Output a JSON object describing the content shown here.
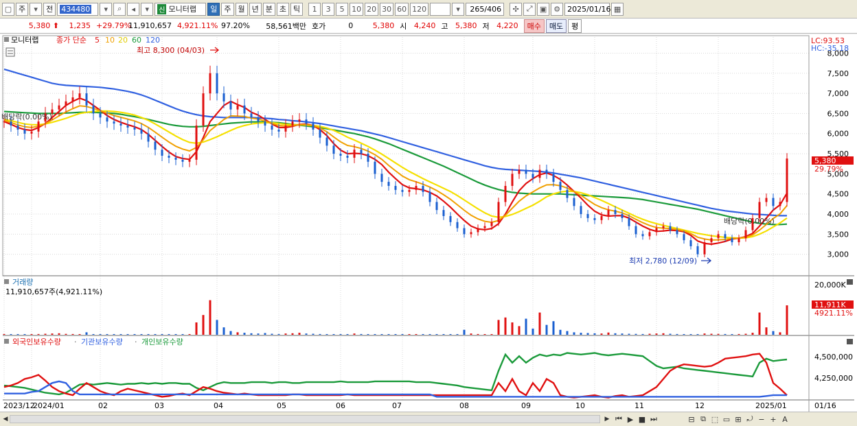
{
  "toolbar": {
    "type_label": "주",
    "all_label": "전",
    "code": "434480",
    "new_badge": "신",
    "stock_name": "모니터랩",
    "period_buttons": [
      "일",
      "주",
      "월",
      "년",
      "분",
      "초",
      "틱"
    ],
    "interval_buttons": [
      "1",
      "3",
      "5",
      "10",
      "20",
      "30",
      "60",
      "120"
    ],
    "count": "265",
    "total": "/406",
    "date": "2025/01/16"
  },
  "quote": {
    "price": "5,380",
    "change": "1,235",
    "change_pct": "+29.79%",
    "volume": "11,910,657",
    "volume_pct": "4,921.11%",
    "ratio": "97.20%",
    "amount": "58,561백만",
    "bid_label": "호가",
    "bid_value": "0",
    "last": "5,380",
    "open_label": "시",
    "open": "4,240",
    "high_label": "고",
    "high": "5,380",
    "low_label": "저",
    "low": "4,220",
    "buy_label": "매수",
    "sell_label": "매도",
    "avg_label": "평"
  },
  "price_panel": {
    "name": "모니터랩",
    "ma_prefix": "종가 단순",
    "ma_periods": [
      "5",
      "10",
      "20",
      "60",
      "120"
    ],
    "ma_colors": [
      "#e01010",
      "#f0a000",
      "#f5e000",
      "#1a9a3a",
      "#3060e0"
    ],
    "max_label": "최고 8,300 (04/03)",
    "min_label": "최저 2,780 (12/09)",
    "dividend_left": "배당락(0.00%)",
    "dividend_right": "배당락(0.00%)",
    "lc": "LC:93.53",
    "hc": "HC:-35.18",
    "last_price_tag": "5,380",
    "last_pct_tag": "29.79%"
  },
  "volume_panel": {
    "name": "거래량",
    "value_label": "11,910,657주(4,921.11%)",
    "axis_top": "20,000K",
    "tag_value": "11,911K",
    "tag_pct": "4921.11%"
  },
  "holding_panel": {
    "series": [
      "외국인보유수량",
      "기관보유수량",
      "개인보유수량"
    ],
    "series_colors": [
      "#e01010",
      "#3060e0",
      "#1a9a3a"
    ],
    "ticks": [
      "4,500,000",
      "4,250,000"
    ]
  },
  "x_axis": {
    "labels": [
      "2023/12",
      "2024/01",
      "02",
      "03",
      "04",
      "05",
      "06",
      "07",
      "08",
      "09",
      "10",
      "11",
      "12",
      "2025/01",
      "01/16"
    ]
  },
  "chart_data": {
    "type": "line",
    "price_axis": {
      "ticks": [
        8000,
        7500,
        7000,
        6500,
        6000,
        5500,
        5000,
        4500,
        4000,
        3500,
        3000
      ],
      "tick_labels": [
        "8,000",
        "7,500",
        "7,000",
        "6,500",
        "6,000",
        "5,500",
        "5,000",
        "4,500",
        "4,000",
        "3,500",
        "3,000"
      ],
      "ylim": [
        2500,
        8400
      ]
    },
    "close": [
      6300,
      6200,
      6100,
      6000,
      6050,
      6300,
      6500,
      6600,
      6700,
      6800,
      6900,
      7000,
      6700,
      6500,
      6400,
      6300,
      6250,
      6200,
      6150,
      6100,
      6000,
      5800,
      5600,
      5450,
      5400,
      5350,
      5300,
      5350,
      6200,
      7000,
      7500,
      7000,
      6800,
      6600,
      6700,
      6500,
      6400,
      6300,
      6200,
      6100,
      6050,
      6200,
      6300,
      6350,
      6250,
      6100,
      5900,
      5700,
      5500,
      5450,
      5400,
      5600,
      5500,
      5300,
      5000,
      4800,
      4700,
      4600,
      4550,
      4600,
      4700,
      4550,
      4300,
      4100,
      3950,
      3800,
      3650,
      3500,
      3550,
      3650,
      3700,
      3800,
      4300,
      4700,
      5000,
      5100,
      5000,
      4900,
      5100,
      5000,
      4800,
      4600,
      4400,
      4200,
      4000,
      3900,
      3850,
      3950,
      4100,
      4000,
      3900,
      3700,
      3500,
      3450,
      3550,
      3650,
      3700,
      3600,
      3500,
      3350,
      3200,
      3000,
      3300,
      3400,
      3500,
      3400,
      3300,
      3400,
      3600,
      3900,
      4300,
      4400,
      4200,
      4300,
      5380
    ],
    "ma5": [
      6300,
      6230,
      6150,
      6100,
      6080,
      6150,
      6250,
      6400,
      6550,
      6700,
      6800,
      6880,
      6820,
      6700,
      6580,
      6450,
      6350,
      6280,
      6220,
      6170,
      6100,
      5980,
      5830,
      5680,
      5540,
      5430,
      5380,
      5360,
      5550,
      5900,
      6300,
      6500,
      6700,
      6800,
      6720,
      6650,
      6530,
      6460,
      6350,
      6240,
      6150,
      6150,
      6180,
      6230,
      6240,
      6200,
      6100,
      5950,
      5750,
      5590,
      5500,
      5510,
      5500,
      5450,
      5360,
      5230,
      5040,
      4880,
      4730,
      4650,
      4630,
      4600,
      4540,
      4450,
      4320,
      4170,
      4000,
      3840,
      3700,
      3630,
      3610,
      3640,
      3760,
      4000,
      4300,
      4580,
      4760,
      4880,
      4980,
      5020,
      4960,
      4860,
      4720,
      4560,
      4400,
      4220,
      4070,
      3980,
      3950,
      3960,
      3960,
      3900,
      3800,
      3700,
      3620,
      3570,
      3580,
      3600,
      3590,
      3560,
      3470,
      3330,
      3270,
      3250,
      3280,
      3320,
      3380,
      3400,
      3440,
      3520,
      3700,
      3900,
      4100,
      4230,
      4520
    ],
    "ma20": [
      6350,
      6320,
      6280,
      6240,
      6220,
      6220,
      6240,
      6280,
      6330,
      6380,
      6440,
      6500,
      6530,
      6550,
      6560,
      6560,
      6550,
      6530,
      6500,
      6460,
      6400,
      6330,
      6240,
      6140,
      6040,
      5940,
      5850,
      5780,
      5760,
      5790,
      5850,
      5920,
      6000,
      6080,
      6150,
      6200,
      6240,
      6260,
      6270,
      6270,
      6250,
      6230,
      6220,
      6220,
      6210,
      6200,
      6180,
      6140,
      6080,
      6000,
      5910,
      5840,
      5760,
      5680,
      5590,
      5490,
      5380,
      5270,
      5160,
      5060,
      4970,
      4880,
      4800,
      4720,
      4640,
      4560,
      4460,
      4350,
      4240,
      4130,
      4030,
      3950,
      3920,
      3940,
      3990,
      4060,
      4140,
      4220,
      4320,
      4430,
      4500,
      4550,
      4570,
      4560,
      4530,
      4480,
      4410,
      4340,
      4260,
      4180,
      4100,
      4020,
      3940,
      3870,
      3810,
      3760,
      3720,
      3680,
      3640,
      3600,
      3560,
      3520,
      3490,
      3460,
      3440,
      3420,
      3410,
      3400,
      3410,
      3440,
      3500,
      3580,
      3680,
      3780,
      3900
    ],
    "ma60": [
      6550,
      6540,
      6530,
      6520,
      6510,
      6500,
      6500,
      6500,
      6500,
      6510,
      6520,
      6530,
      6530,
      6530,
      6520,
      6510,
      6500,
      6480,
      6450,
      6420,
      6390,
      6350,
      6310,
      6270,
      6230,
      6200,
      6180,
      6170,
      6170,
      6180,
      6200,
      6220,
      6240,
      6260,
      6270,
      6280,
      6290,
      6290,
      6290,
      6280,
      6270,
      6250,
      6230,
      6210,
      6190,
      6170,
      6150,
      6120,
      6090,
      6060,
      6030,
      6000,
      5960,
      5920,
      5870,
      5810,
      5750,
      5680,
      5610,
      5540,
      5470,
      5400,
      5330,
      5260,
      5190,
      5110,
      5030,
      4950,
      4870,
      4790,
      4720,
      4660,
      4610,
      4570,
      4540,
      4520,
      4510,
      4500,
      4500,
      4500,
      4500,
      4500,
      4490,
      4480,
      4470,
      4460,
      4450,
      4440,
      4430,
      4420,
      4410,
      4400,
      4380,
      4360,
      4330,
      4300,
      4270,
      4240,
      4210,
      4180,
      4150,
      4120,
      4080,
      4040,
      4000,
      3960,
      3920,
      3880,
      3840,
      3800,
      3770,
      3750,
      3740,
      3740,
      3750
    ],
    "ma120": [
      7600,
      7550,
      7500,
      7450,
      7400,
      7350,
      7300,
      7250,
      7220,
      7200,
      7190,
      7180,
      7170,
      7160,
      7150,
      7130,
      7110,
      7080,
      7050,
      7010,
      6960,
      6900,
      6830,
      6760,
      6690,
      6620,
      6560,
      6510,
      6470,
      6440,
      6420,
      6410,
      6400,
      6400,
      6400,
      6400,
      6400,
      6390,
      6380,
      6370,
      6350,
      6340,
      6320,
      6310,
      6290,
      6270,
      6250,
      6220,
      6190,
      6160,
      6130,
      6100,
      6070,
      6030,
      5990,
      5950,
      5900,
      5850,
      5800,
      5750,
      5700,
      5650,
      5600,
      5550,
      5500,
      5450,
      5400,
      5350,
      5300,
      5250,
      5200,
      5160,
      5130,
      5110,
      5100,
      5090,
      5080,
      5070,
      5060,
      5040,
      5020,
      4990,
      4960,
      4930,
      4900,
      4860,
      4820,
      4780,
      4740,
      4700,
      4660,
      4620,
      4580,
      4540,
      4500,
      4460,
      4420,
      4380,
      4340,
      4300,
      4260,
      4220,
      4180,
      4140,
      4110,
      4080,
      4060,
      4040,
      4020,
      4000,
      3990,
      3980,
      3970,
      3960,
      3960
    ],
    "volume_axis": {
      "ylim": [
        0,
        20000
      ]
    },
    "volume_k": [
      300,
      200,
      150,
      120,
      250,
      300,
      400,
      500,
      600,
      350,
      300,
      250,
      1000,
      200,
      150,
      150,
      120,
      100,
      130,
      150,
      120,
      110,
      100,
      90,
      80,
      90,
      100,
      120,
      5000,
      8000,
      14000,
      6000,
      3000,
      1500,
      1000,
      800,
      600,
      500,
      700,
      400,
      300,
      500,
      600,
      800,
      500,
      400,
      300,
      250,
      200,
      180,
      200,
      500,
      300,
      250,
      200,
      180,
      150,
      130,
      120,
      140,
      200,
      180,
      160,
      150,
      140,
      150,
      200,
      2000,
      500,
      300,
      200,
      150,
      6000,
      7000,
      5000,
      3500,
      6500,
      2500,
      9000,
      4000,
      5500,
      2000,
      1500,
      1000,
      800,
      700,
      600,
      500,
      900,
      600,
      500,
      400,
      350,
      300,
      400,
      500,
      600,
      400,
      300,
      250,
      200,
      180,
      500,
      400,
      350,
      300,
      250,
      300,
      400,
      800,
      9000,
      3000,
      1500,
      1000,
      11911
    ],
    "holding_axis": {
      "ylim": [
        4050000,
        4700000
      ]
    },
    "foreign": [
      4200000,
      4220000,
      4250000,
      4300000,
      4320000,
      4350000,
      4280000,
      4200000,
      4150000,
      4120000,
      4100000,
      4180000,
      4250000,
      4200000,
      4150000,
      4120000,
      4100000,
      4150000,
      4180000,
      4160000,
      4140000,
      4120000,
      4100000,
      4080000,
      4090000,
      4110000,
      4120000,
      4100000,
      4150000,
      4200000,
      4180000,
      4150000,
      4130000,
      4120000,
      4110000,
      4120000,
      4110000,
      4100000,
      4100000,
      4100000,
      4100000,
      4100000,
      4110000,
      4110000,
      4100000,
      4100000,
      4100000,
      4100000,
      4100000,
      4100000,
      4110000,
      4100000,
      4100000,
      4100000,
      4100000,
      4100000,
      4100000,
      4100000,
      4100000,
      4100000,
      4100000,
      4100000,
      4100000,
      4100000,
      4100000,
      4100000,
      4100000,
      4100000,
      4100000,
      4100000,
      4100000,
      4100000,
      4250000,
      4150000,
      4300000,
      4150000,
      4100000,
      4250000,
      4150000,
      4300000,
      4250000,
      4100000,
      4080000,
      4070000,
      4080000,
      4090000,
      4100000,
      4080000,
      4070000,
      4090000,
      4100000,
      4080000,
      4090000,
      4100000,
      4150000,
      4200000,
      4300000,
      4400000,
      4450000,
      4480000,
      4470000,
      4460000,
      4450000,
      4460000,
      4500000,
      4550000,
      4560000,
      4570000,
      4580000,
      4600000,
      4610000,
      4500000,
      4250000,
      4180000,
      4100000
    ],
    "institution": [
      4120000,
      4120000,
      4120000,
      4120000,
      4140000,
      4150000,
      4200000,
      4250000,
      4270000,
      4250000,
      4150000,
      4110000,
      4110000,
      4110000,
      4110000,
      4110000,
      4110000,
      4110000,
      4110000,
      4110000,
      4110000,
      4110000,
      4110000,
      4110000,
      4110000,
      4110000,
      4110000,
      4110000,
      4110000,
      4110000,
      4110000,
      4110000,
      4110000,
      4110000,
      4110000,
      4110000,
      4110000,
      4110000,
      4110000,
      4110000,
      4110000,
      4110000,
      4110000,
      4110000,
      4110000,
      4110000,
      4110000,
      4110000,
      4110000,
      4110000,
      4110000,
      4110000,
      4110000,
      4110000,
      4110000,
      4110000,
      4110000,
      4110000,
      4110000,
      4110000,
      4110000,
      4110000,
      4110000,
      4080000,
      4080000,
      4080000,
      4080000,
      4080000,
      4080000,
      4080000,
      4080000,
      4080000,
      4080000,
      4080000,
      4080000,
      4080000,
      4080000,
      4080000,
      4080000,
      4080000,
      4080000,
      4080000,
      4080000,
      4080000,
      4080000,
      4080000,
      4080000,
      4080000,
      4080000,
      4080000,
      4080000,
      4080000,
      4080000,
      4080000,
      4080000,
      4080000,
      4080000,
      4080000,
      4080000,
      4080000,
      4080000,
      4080000,
      4080000,
      4080000,
      4080000,
      4080000,
      4080000,
      4080000,
      4080000,
      4080000,
      4080000,
      4090000,
      4100000,
      4100000,
      4100000
    ],
    "individual": [
      4220000,
      4210000,
      4200000,
      4190000,
      4170000,
      4150000,
      4130000,
      4120000,
      4110000,
      4130000,
      4180000,
      4230000,
      4240000,
      4230000,
      4240000,
      4250000,
      4240000,
      4230000,
      4240000,
      4240000,
      4250000,
      4240000,
      4250000,
      4240000,
      4250000,
      4250000,
      4240000,
      4240000,
      4190000,
      4160000,
      4200000,
      4240000,
      4260000,
      4250000,
      4250000,
      4250000,
      4260000,
      4260000,
      4260000,
      4250000,
      4260000,
      4260000,
      4250000,
      4250000,
      4260000,
      4260000,
      4260000,
      4260000,
      4260000,
      4270000,
      4260000,
      4260000,
      4260000,
      4260000,
      4270000,
      4270000,
      4270000,
      4270000,
      4270000,
      4270000,
      4260000,
      4260000,
      4260000,
      4250000,
      4240000,
      4230000,
      4220000,
      4200000,
      4190000,
      4180000,
      4170000,
      4160000,
      4400000,
      4600000,
      4500000,
      4580000,
      4500000,
      4560000,
      4600000,
      4580000,
      4600000,
      4590000,
      4620000,
      4610000,
      4600000,
      4610000,
      4620000,
      4600000,
      4590000,
      4600000,
      4610000,
      4600000,
      4590000,
      4580000,
      4520000,
      4460000,
      4430000,
      4440000,
      4450000,
      4430000,
      4420000,
      4410000,
      4400000,
      4390000,
      4380000,
      4370000,
      4360000,
      4350000,
      4340000,
      4330000,
      4500000,
      4550000,
      4520000,
      4530000,
      4540000
    ]
  }
}
